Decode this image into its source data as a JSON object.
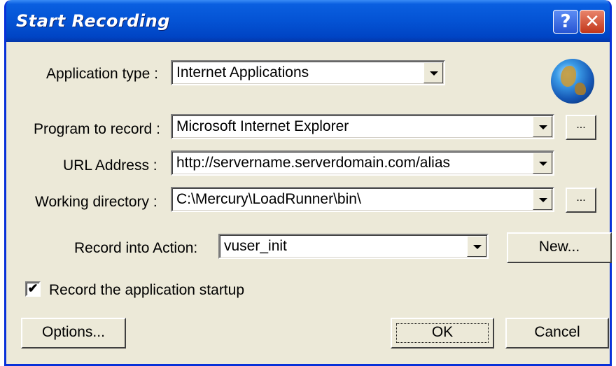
{
  "window": {
    "title": "Start Recording",
    "help_label": "?",
    "close_label": "✕"
  },
  "fields": {
    "application_type": {
      "label": "Application type :",
      "value": "Internet Applications"
    },
    "program_to_record": {
      "label": "Program to record :",
      "value": "Microsoft Internet Explorer"
    },
    "url_address": {
      "label": "URL Address :",
      "value": "http://servername.serverdomain.com/alias"
    },
    "working_directory": {
      "label": "Working directory :",
      "value": "C:\\Mercury\\LoadRunner\\bin\\"
    },
    "record_into_action": {
      "label": "Record into Action:",
      "value": "vuser_init"
    }
  },
  "browse_label": "...",
  "new_button": "New...",
  "checkbox": {
    "label": "Record the application startup",
    "checked": true,
    "mark": "✔"
  },
  "buttons": {
    "options": "Options...",
    "ok": "OK",
    "cancel": "Cancel"
  },
  "icons": {
    "globe": "globe-icon"
  }
}
